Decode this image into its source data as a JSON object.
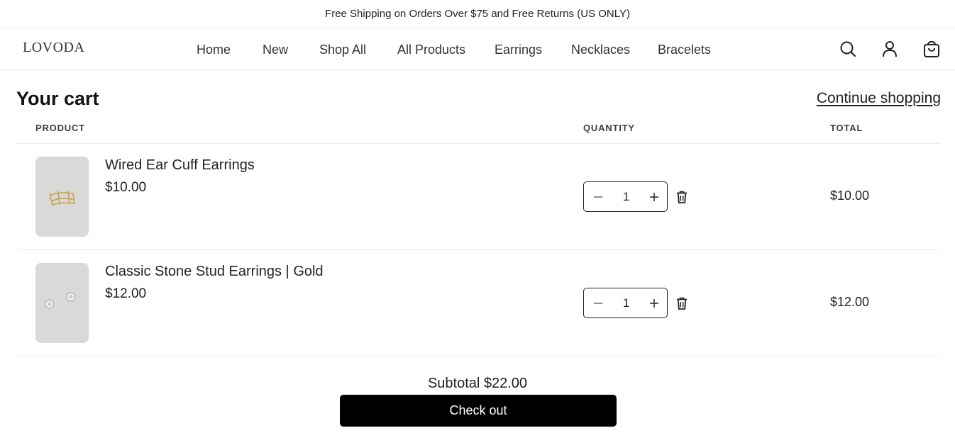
{
  "announcement": "Free Shipping on Orders Over $75 and Free Returns (US ONLY)",
  "header": {
    "logo": "LOVODA",
    "nav": [
      "Home",
      "New",
      "Shop All",
      "All Products",
      "Earrings",
      "Necklaces",
      "Bracelets"
    ],
    "icons": [
      "search-icon",
      "account-icon",
      "cart-icon"
    ]
  },
  "cart": {
    "title": "Your cart",
    "continue_label": "Continue shopping",
    "columns": {
      "product": "PRODUCT",
      "quantity": "QUANTITY",
      "total": "TOTAL"
    },
    "items": [
      {
        "name": "Wired Ear Cuff Earrings",
        "price": "$10.00",
        "quantity": "1",
        "total": "$10.00"
      },
      {
        "name": "Classic Stone Stud Earrings | Gold",
        "price": "$12.00",
        "quantity": "1",
        "total": "$12.00"
      }
    ]
  },
  "summary": {
    "subtotal": "Subtotal $22.00",
    "checkout_label": "Check out"
  },
  "colors": {
    "checkout_bg": "#000000",
    "thumb_bg": "#d9d9d9",
    "divider": "#ececec"
  }
}
